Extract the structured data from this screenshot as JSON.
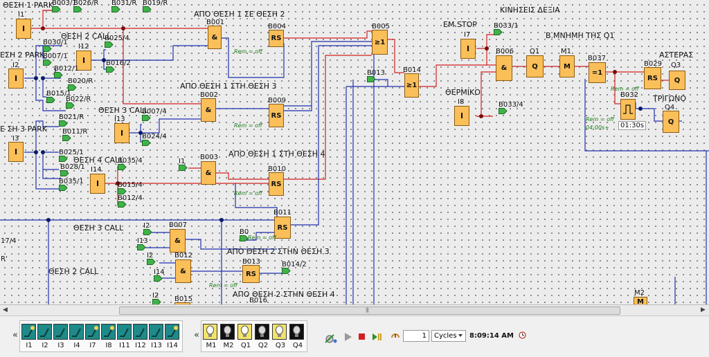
{
  "titles": {
    "t1": "ΑΠΟ ΘΕΣΗ 1 ΣΕ ΘΕΣΗ 2",
    "t2": "ΑΠΟ ΘΕΣΗ 1 ΣΤΗ ΘΕΣΗ 3",
    "t3": "ΑΠΟ ΘΕΣΗ 1 ΣΤΗ ΘΕΣΗ 4",
    "t4": "ΑΠΟ ΘΕΣΗ 2 ΣΤΗΝ ΘΕΣΗ 3",
    "t5": "ΑΠΟ ΘΕΣΗ 2 ΣΤΗΝ ΘΕΣΗ 4",
    "t6": "ΚΙΝΗΣΕΙΣ ΔΕΞΙΑ",
    "t7": "Β.ΜΝΗΜΗ ΤΗΣ Q1",
    "t8": "ΑΣΤΕΡΑΣ",
    "t9": "ΤΡΙΓΩΝΟ",
    "t10": "ΕΜ.STOP",
    "t11": "ΘΕΡΜΙΚΟ",
    "t12": "ΘΕΣΗ 1 PARK",
    "t13": "ΘΕΣΗ 2 CALL",
    "t14": "ΕΣΗ 2 PARK",
    "t15": "ΘΕΣΗ 3 CALL",
    "t16": "Ε ΣΗ 3 PARK",
    "t17": "ΘΕΣΗ 4 CALL",
    "t18": "ΘΕΣΗ 3 CALL",
    "t19": "ΘΕΣΗ 2 CALL",
    "t20": "17/4",
    "t21": "R'"
  },
  "blocks": {
    "I1": "I1",
    "I2": "I2",
    "I3": "I3",
    "I7": "I7",
    "I8": "I8",
    "I12": "I12",
    "I13": "I13",
    "I14": "I14",
    "B001": "B001",
    "B002": "B002",
    "B003": "B003",
    "B004": "B004",
    "B005": "B005",
    "B006": "B006",
    "B007": "B007",
    "B009": "B009",
    "B010": "B010",
    "B011": "B011",
    "B012": "B012",
    "B013": "B013",
    "B014": "B014",
    "B015": "B015",
    "B016": "B016",
    "B029": "B029",
    "B032": "B032",
    "B037": "B037",
    "Q1": "Q1",
    "Q3": "Q3",
    "Q4": "Q4",
    "M1": "M1",
    "M2": "M2",
    "sym_and": "&",
    "sym_rs": "RS",
    "sym_or": "≥1",
    "sym_xor": "=1",
    "sym_q": "Q",
    "sym_m": "M",
    "sym_i": "I"
  },
  "flags": {
    "f_b003_1": "B003/1",
    "f_b026_r": "B026/R",
    "f_b031_r": "B031/R",
    "f_b019_r": "B019/R",
    "f_b030_1": "B030/1",
    "f_b007_1": "B007/1",
    "f_b012_1": "B012/1",
    "f_b020_r": "B020/R",
    "f_b015_1": "B015/1",
    "f_b022_r": "B022/R",
    "f_b025_4": "B025/4",
    "f_b016_2": "B016/2",
    "f_b021_r": "B021/R",
    "f_b011_r": "B011/R",
    "f_b025_1": "B025/1",
    "f_b028_1": "B028/1",
    "f_b035_1": "B035/1",
    "f_b007_4": "B007/4",
    "f_b024_4": "B024/4",
    "f_b035_4": "B035/4",
    "f_b015_4": "B015/4",
    "f_b012_4": "B012/4",
    "f_i1": "I1",
    "f_b033_1": "B033/1",
    "f_b033_4": "B033/4",
    "f_b013": "B013",
    "f_i2": "I2",
    "f_i13": "I13",
    "f_i2b": "I2",
    "f_i14": "I14",
    "f_b014_2": "B014/2",
    "f_b0": "B0",
    "f_i2c": "I2"
  },
  "rem": "Rem = off",
  "timer": {
    "val": "01:30s",
    "param": "04:00s+"
  },
  "toolbar": {
    "inputs": [
      {
        "label": "I1",
        "on": true
      },
      {
        "label": "I2",
        "on": false
      },
      {
        "label": "I3",
        "on": false
      },
      {
        "label": "I4",
        "on": false
      },
      {
        "label": "I7",
        "on": true
      },
      {
        "label": "I8",
        "on": true
      },
      {
        "label": "I11",
        "on": false
      },
      {
        "label": "I12",
        "on": false
      },
      {
        "label": "I13",
        "on": false
      },
      {
        "label": "I14",
        "on": true
      }
    ],
    "outputs": [
      {
        "label": "M1",
        "on": true
      },
      {
        "label": "M2",
        "on": false
      },
      {
        "label": "Q1",
        "on": true
      },
      {
        "label": "Q2",
        "on": false
      },
      {
        "label": "Q3",
        "on": true
      },
      {
        "label": "Q4",
        "on": false
      }
    ],
    "cycles_value": "1",
    "cycles_unit": "Cycles",
    "sim_time": "8:09:14 AM",
    "collapse_glyph": "«"
  },
  "colors": {
    "active_wire": "#d42020",
    "inactive_wire": "#2030b0",
    "block": "#fbbf5a"
  }
}
